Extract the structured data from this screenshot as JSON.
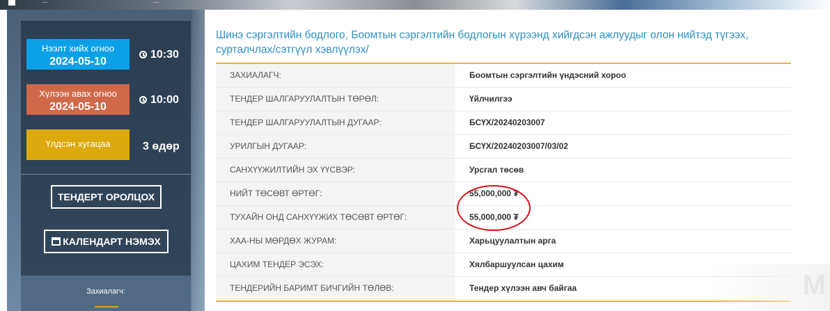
{
  "header": {
    "breadcrumb_1": "...",
    "breadcrumb_2": "..."
  },
  "sidebar": {
    "start_date": {
      "label": "Нээлт хийх огноо",
      "date": "2024-05-10",
      "time": "10:30"
    },
    "end_date": {
      "label": "Хүлээн авах огноо",
      "date": "2024-05-10",
      "time": "10:00"
    },
    "remaining": {
      "label": "Үлдсэн хугацаа",
      "value": "3 өдөр"
    },
    "buttons": {
      "participate": "ТЕНДЕРТ ОРОЛЦОХ",
      "calendar": "КАЛЕНДАРТ НЭМЭХ"
    },
    "client_label": "Захиалагч:"
  },
  "main": {
    "title": "Шинэ сэргэлтийн бодлого, Боомтын сэргэлтийн бодлогын хүрээнд хийгдсэн ажлуудыг олон нийтэд түгээх, сурталчлах/сэтгүүл хэвлүүлэх/",
    "rows": [
      {
        "key": "ЗАХИАЛАГЧ:",
        "value": "Боомтын сэргэлтийн үндэсний хороо"
      },
      {
        "key": "ТЕНДЕР ШАЛГАРУУЛАЛТЫН ТӨРӨЛ:",
        "value": "Үйлчилгээ"
      },
      {
        "key": "ТЕНДЕР ШАЛГАРУУЛАЛТЫН ДУГААР:",
        "value": "БСҮХ/20240203007"
      },
      {
        "key": "УРИЛГЫН ДУГААР:",
        "value": "БСҮХ/20240203007/03/02"
      },
      {
        "key": "САНХҮҮЖИЛТИЙН ЭХ ҮҮСВЭР:",
        "value": "Урсгал төсөв"
      },
      {
        "key": "НИЙТ ТӨСӨВТ ӨРТӨГ:",
        "value": "55,000,000 ₮"
      },
      {
        "key": "ТУХАЙН ОНД САНХҮҮЖИХ ТӨСӨВТ ӨРТӨГ:",
        "value": "55,000,000 ₮"
      },
      {
        "key": "ХАА-НЫ МӨРДӨХ ЖУРАМ:",
        "value": "Харьцуулалтын арга"
      },
      {
        "key": "ЦАХИМ ТЕНДЕР ЭСЭХ:",
        "value": "Хялбаршуулсан цахим"
      },
      {
        "key": "ТЕНДЕРИЙН БАРИМТ БИЧГИЙН ТӨЛӨВ:",
        "value": "Тендер хүлээн авч байгаа"
      }
    ]
  },
  "watermark": "M",
  "colors": {
    "accent": "#2f8fc2",
    "border": "#f0b22e",
    "start": "#0ea0e6",
    "end": "#d0694a",
    "remaining": "#dca90e",
    "highlight": "#d9141c"
  }
}
